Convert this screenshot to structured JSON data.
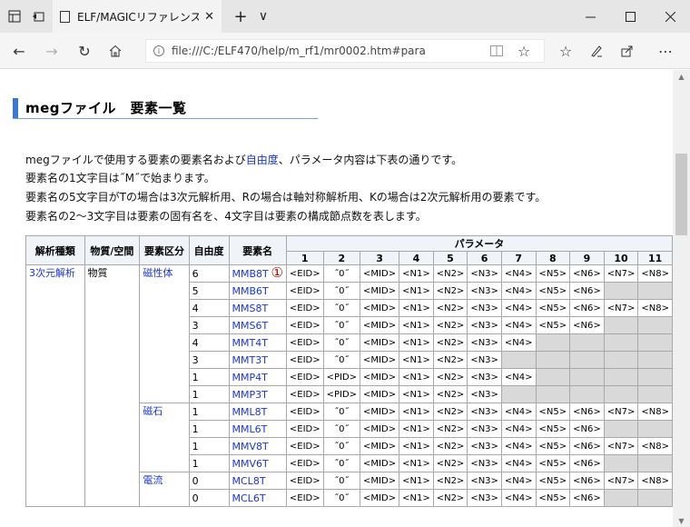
{
  "browser": {
    "tab_title": "ELF/MAGICリファレンス 要",
    "url": "file:///C:/ELF470/help/m_rf1/mr0002.htm#para",
    "new_tab": "+",
    "tab_menu": "∨"
  },
  "page": {
    "heading": "megファイル　要素一覧",
    "para1_pre": "megファイルで使用する要素の要素名および",
    "para1_link": "自由度",
    "para1_post": "、パラメータ内容は下表の通りです。",
    "para2": "要素名の1文字目は˝M˝で始まります。",
    "para3": "要素名の5文字目がTの場合は3次元解析用、Rの場合は軸対称解析用、Kの場合は2次元解析用の要素です。",
    "para4": "要素名の2～3文字目は要素の固有名を、4文字目は要素の構成節点数を表します。",
    "marker": "①"
  },
  "table": {
    "headers": {
      "analysis": "解析種類",
      "material": "物質/空間",
      "category": "要素区分",
      "dof": "自由度",
      "name": "要素名",
      "params": "パラメータ",
      "cols": [
        "1",
        "2",
        "3",
        "4",
        "5",
        "6",
        "7",
        "8",
        "9",
        "10",
        "11"
      ]
    },
    "groups": {
      "analysis": "3次元解析",
      "material": "物質",
      "cat1": "磁性体",
      "cat2": "磁石",
      "cat3": "電流"
    },
    "rows": [
      {
        "dof": "6",
        "name": "MMB8T",
        "p": [
          "<EID>",
          "˝0˝",
          "<MID>",
          "<N1>",
          "<N2>",
          "<N3>",
          "<N4>",
          "<N5>",
          "<N6>",
          "<N7>",
          "<N8>"
        ]
      },
      {
        "dof": "5",
        "name": "MMB6T",
        "p": [
          "<EID>",
          "˝0˝",
          "<MID>",
          "<N1>",
          "<N2>",
          "<N3>",
          "<N4>",
          "<N5>",
          "<N6>",
          "",
          ""
        ]
      },
      {
        "dof": "4",
        "name": "MMS8T",
        "p": [
          "<EID>",
          "˝0˝",
          "<MID>",
          "<N1>",
          "<N2>",
          "<N3>",
          "<N4>",
          "<N5>",
          "<N6>",
          "<N7>",
          "<N8>"
        ]
      },
      {
        "dof": "3",
        "name": "MMS6T",
        "p": [
          "<EID>",
          "˝0˝",
          "<MID>",
          "<N1>",
          "<N2>",
          "<N3>",
          "<N4>",
          "<N5>",
          "<N6>",
          "",
          ""
        ]
      },
      {
        "dof": "4",
        "name": "MMT4T",
        "p": [
          "<EID>",
          "˝0˝",
          "<MID>",
          "<N1>",
          "<N2>",
          "<N3>",
          "<N4>",
          "",
          "",
          "",
          ""
        ]
      },
      {
        "dof": "3",
        "name": "MMT3T",
        "p": [
          "<EID>",
          "˝0˝",
          "<MID>",
          "<N1>",
          "<N2>",
          "<N3>",
          "",
          "",
          "",
          "",
          ""
        ]
      },
      {
        "dof": "1",
        "name": "MMP4T",
        "p": [
          "<EID>",
          "<PID>",
          "<MID>",
          "<N1>",
          "<N2>",
          "<N3>",
          "<N4>",
          "",
          "",
          "",
          ""
        ]
      },
      {
        "dof": "1",
        "name": "MMP3T",
        "p": [
          "<EID>",
          "<PID>",
          "<MID>",
          "<N1>",
          "<N2>",
          "<N3>",
          "",
          "",
          "",
          "",
          ""
        ]
      },
      {
        "dof": "1",
        "name": "MML8T",
        "p": [
          "<EID>",
          "˝0˝",
          "<MID>",
          "<N1>",
          "<N2>",
          "<N3>",
          "<N4>",
          "<N5>",
          "<N6>",
          "<N7>",
          "<N8>"
        ]
      },
      {
        "dof": "1",
        "name": "MML6T",
        "p": [
          "<EID>",
          "˝0˝",
          "<MID>",
          "<N1>",
          "<N2>",
          "<N3>",
          "<N4>",
          "<N5>",
          "<N6>",
          "",
          ""
        ]
      },
      {
        "dof": "1",
        "name": "MMV8T",
        "p": [
          "<EID>",
          "˝0˝",
          "<MID>",
          "<N1>",
          "<N2>",
          "<N3>",
          "<N4>",
          "<N5>",
          "<N6>",
          "<N7>",
          "<N8>"
        ]
      },
      {
        "dof": "1",
        "name": "MMV6T",
        "p": [
          "<EID>",
          "˝0˝",
          "<MID>",
          "<N1>",
          "<N2>",
          "<N3>",
          "<N4>",
          "<N5>",
          "<N6>",
          "",
          ""
        ]
      },
      {
        "dof": "0",
        "name": "MCL8T",
        "p": [
          "<EID>",
          "˝0˝",
          "<MID>",
          "<N1>",
          "<N2>",
          "<N3>",
          "<N4>",
          "<N5>",
          "<N6>",
          "<N7>",
          "<N8>"
        ]
      },
      {
        "dof": "0",
        "name": "MCL6T",
        "p": [
          "<EID>",
          "˝0˝",
          "<MID>",
          "<N1>",
          "<N2>",
          "<N3>",
          "<N4>",
          "<N5>",
          "<N6>",
          "",
          ""
        ]
      }
    ]
  },
  "colors": {
    "link": "#1a37d6",
    "heading_bar": "#3b78d0",
    "empty_cell": "#d9d9d9",
    "marker": "#c00000"
  }
}
